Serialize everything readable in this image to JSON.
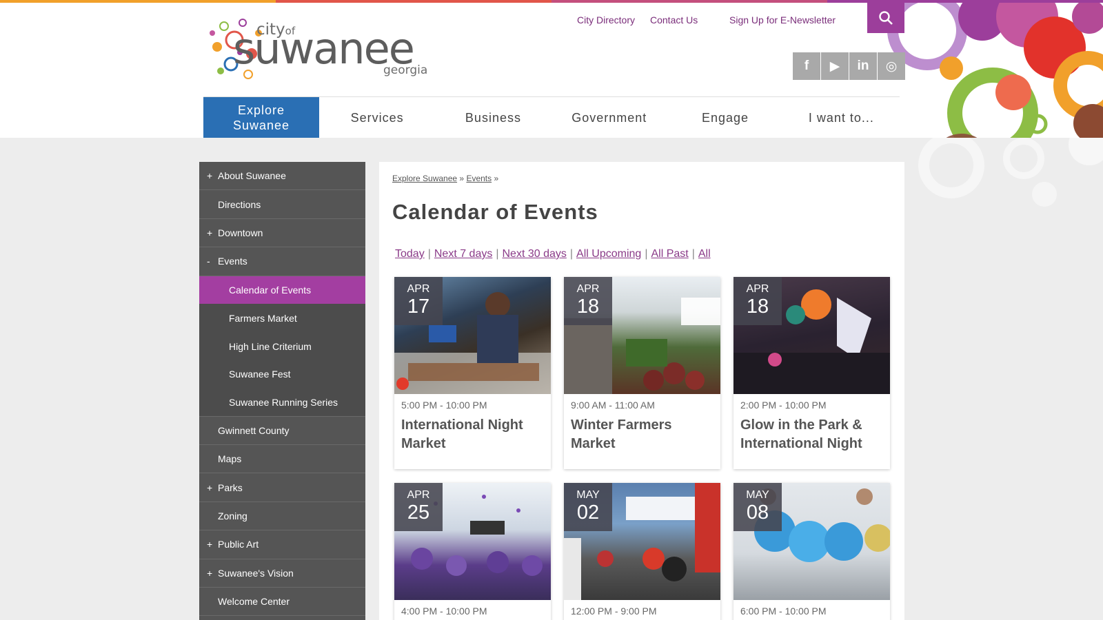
{
  "colors": {
    "topbar": [
      "#f1a02b",
      "#e1564a",
      "#9c3e9b",
      "#7aa63e"
    ],
    "brand_purple": "#9c3e9b",
    "nav_active": "#2a6fb4",
    "sidebar_bg": "#555555",
    "sidebar_current": "#a33ea1",
    "link_purple": "#8a3a88"
  },
  "header": {
    "logo": {
      "city": "city",
      "of": "of",
      "main": "suwanee",
      "sub": "georgia"
    },
    "utility_links": [
      "City Directory",
      "Contact Us",
      "Sign Up for E-Newsletter"
    ],
    "search_icon": "search-icon",
    "social": [
      {
        "icon": "facebook-icon",
        "glyph": "f"
      },
      {
        "icon": "youtube-icon",
        "glyph": "▶"
      },
      {
        "icon": "linkedin-icon",
        "glyph": "in"
      },
      {
        "icon": "instagram-icon",
        "glyph": "◎"
      }
    ]
  },
  "nav": {
    "items": [
      {
        "label": "Explore Suwanee",
        "active": true
      },
      {
        "label": "Services"
      },
      {
        "label": "Business"
      },
      {
        "label": "Government"
      },
      {
        "label": "Engage"
      },
      {
        "label": "I want to..."
      }
    ]
  },
  "sidebar": {
    "items": [
      {
        "label": "About Suwanee",
        "toggle": "+"
      },
      {
        "label": "Directions",
        "toggle": ""
      },
      {
        "label": "Downtown",
        "toggle": "+"
      },
      {
        "label": "Events",
        "toggle": "-"
      },
      {
        "label": "Calendar of Events",
        "sub": true,
        "current": true
      },
      {
        "label": "Farmers Market",
        "sub": true
      },
      {
        "label": "High Line Criterium",
        "sub": true
      },
      {
        "label": "Suwanee Fest",
        "sub": true
      },
      {
        "label": "Suwanee Running Series",
        "sub": true
      },
      {
        "label": "Gwinnett County",
        "toggle": ""
      },
      {
        "label": "Maps",
        "toggle": ""
      },
      {
        "label": "Parks",
        "toggle": "+"
      },
      {
        "label": "Zoning",
        "toggle": ""
      },
      {
        "label": "Public Art",
        "toggle": "+"
      },
      {
        "label": "Suwanee's Vision",
        "toggle": "+"
      },
      {
        "label": "Welcome Center",
        "toggle": ""
      }
    ]
  },
  "main": {
    "breadcrumb": {
      "first": "Explore Suwanee",
      "sep": "»",
      "second": "Events",
      "tail": "»"
    },
    "title": "Calendar of Events",
    "filters": [
      "Today",
      "Next 7 days",
      "Next 30 days",
      "All Upcoming",
      "All Past",
      "All"
    ],
    "filter_sep": "|",
    "events": [
      {
        "month": "APR",
        "day": "17",
        "time": "5:00 PM - 10:00 PM",
        "title": "International Night Market"
      },
      {
        "month": "APR",
        "day": "18",
        "time": "9:00 AM - 11:00 AM",
        "title": "Winter Farmers Market"
      },
      {
        "month": "APR",
        "day": "18",
        "time": "2:00 PM - 10:00 PM",
        "title": "Glow in the Park & International Night"
      },
      {
        "month": "APR",
        "day": "25",
        "time": "4:00 PM - 10:00 PM",
        "title": ""
      },
      {
        "month": "MAY",
        "day": "02",
        "time": "12:00 PM - 9:00 PM",
        "title": ""
      },
      {
        "month": "MAY",
        "day": "08",
        "time": "6:00 PM - 10:00 PM",
        "title": ""
      }
    ]
  }
}
